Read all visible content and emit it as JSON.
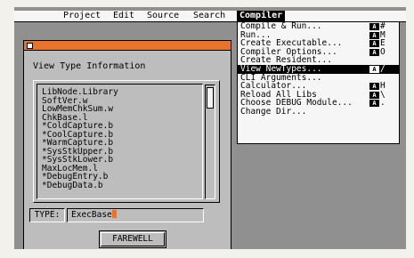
{
  "menubar": {
    "titles": [
      "Project",
      "Edit",
      "Source",
      "Search",
      "Compiler"
    ]
  },
  "window": {
    "title": "View Type Information",
    "list_items": [
      "LibNode.Library",
      "SoftVer.w",
      "LowMemChkSum.w",
      "ChkBase.l",
      "*ColdCapture.b",
      "*CoolCapture.b",
      "*WarmCapture.b",
      "*SysStkUpper.b",
      "*SysStkLower.b",
      "MaxLocMem.l",
      "*DebugEntry.b",
      "*DebugData.b"
    ],
    "type_label": "TYPE:",
    "type_value": "ExecBase",
    "farewell_label": "FAREWELL"
  },
  "compiler_menu": {
    "amiga_glyph": "A",
    "items": [
      {
        "label": "Compile & Run...",
        "key": "#"
      },
      {
        "label": "Run...",
        "key": "M"
      },
      {
        "label": "Create Executable...",
        "key": "E"
      },
      {
        "label": "Compiler Options...",
        "key": "O"
      },
      {
        "label": "Create Resident...",
        "key": ""
      },
      {
        "label": "View NewTypes...",
        "key": "/"
      },
      {
        "label": "CLI Arguments...",
        "key": ""
      },
      {
        "label": "Calculator...",
        "key": "H"
      },
      {
        "label": "Reload All Libs",
        "key": "\\"
      },
      {
        "label": "Choose DEBUG Module...",
        "key": "."
      },
      {
        "label": "Change Dir...",
        "key": ""
      }
    ],
    "selected_index": 5
  },
  "colors": {
    "accent": "#e8732c",
    "screen_bg": "#909090",
    "window_bg": "#bdbdbd"
  }
}
